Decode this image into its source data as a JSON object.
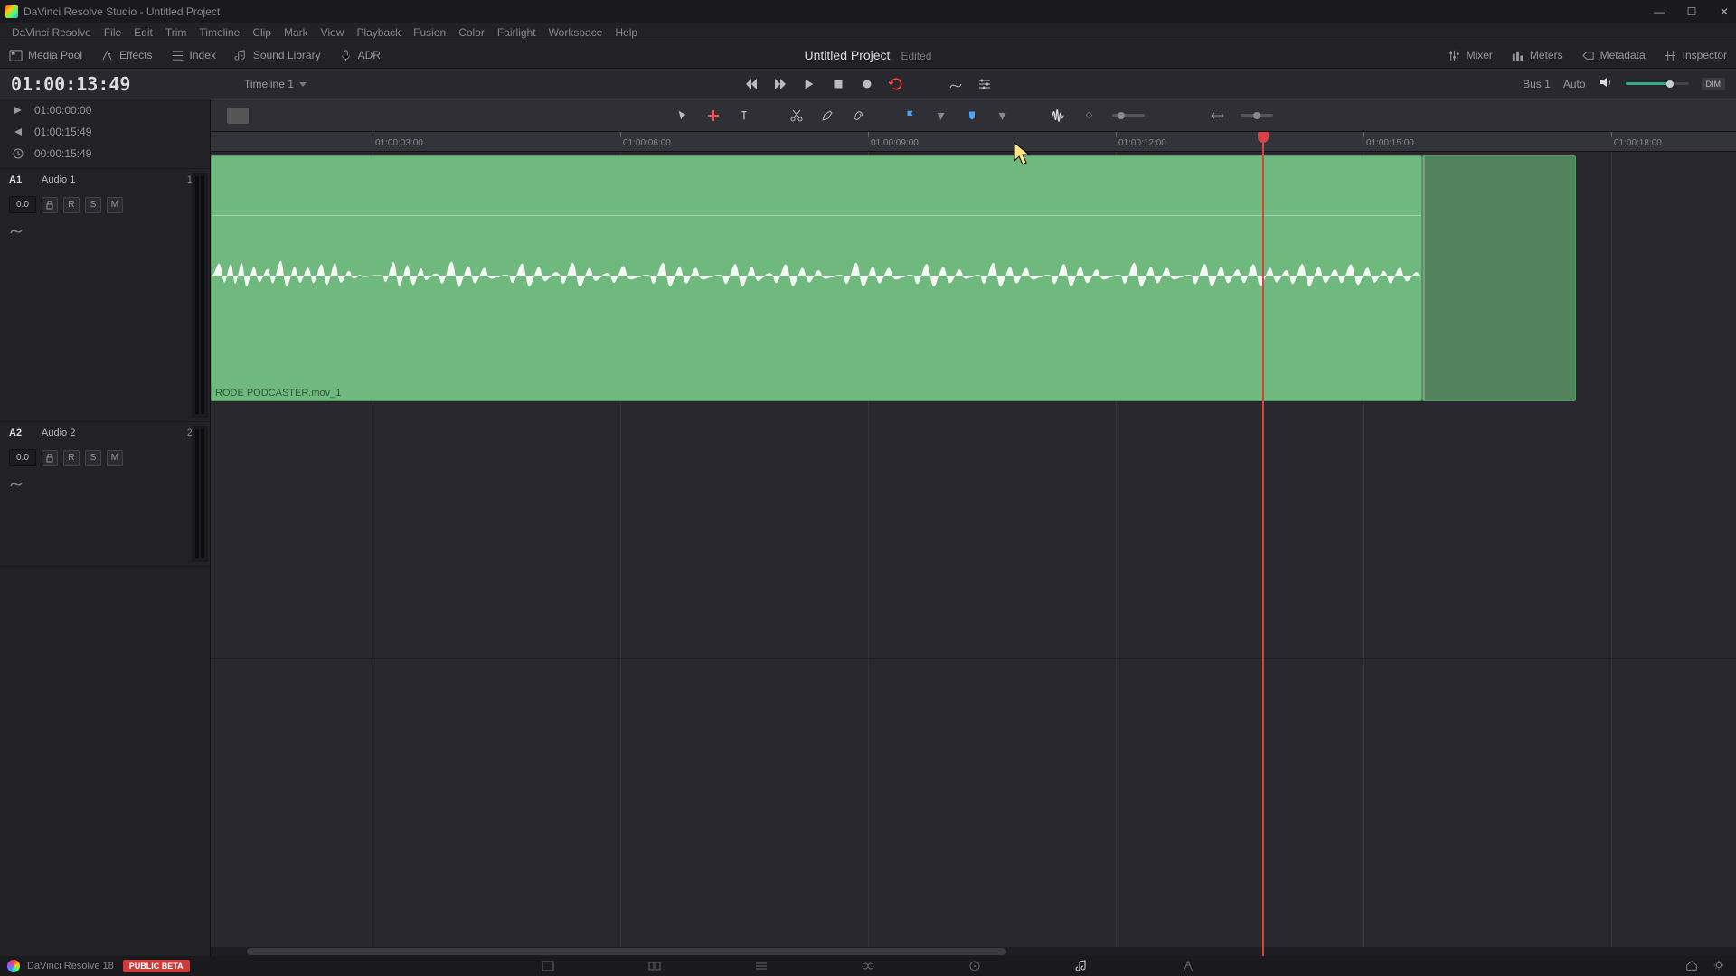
{
  "titlebar": {
    "title": "DaVinci Resolve Studio - Untitled Project"
  },
  "menubar": [
    "DaVinci Resolve",
    "File",
    "Edit",
    "Trim",
    "Timeline",
    "Clip",
    "Mark",
    "View",
    "Playback",
    "Fusion",
    "Color",
    "Fairlight",
    "Workspace",
    "Help"
  ],
  "toptools_left": [
    {
      "icon": "media-pool",
      "label": "Media Pool"
    },
    {
      "icon": "effects",
      "label": "Effects"
    },
    {
      "icon": "index",
      "label": "Index"
    },
    {
      "icon": "sound-library",
      "label": "Sound Library"
    },
    {
      "icon": "adr",
      "label": "ADR"
    }
  ],
  "toptools_right": [
    {
      "icon": "mixer",
      "label": "Mixer"
    },
    {
      "icon": "meters",
      "label": "Meters"
    },
    {
      "icon": "metadata",
      "label": "Metadata"
    },
    {
      "icon": "inspector",
      "label": "Inspector"
    }
  ],
  "project": {
    "name": "Untitled Project",
    "state": "Edited"
  },
  "transport": {
    "timecode": "01:00:13:49",
    "timeline_name": "Timeline 1",
    "bus_label": "Bus 1",
    "auto_label": "Auto",
    "dim_label": "DIM"
  },
  "markers": [
    {
      "icon": "tri-right",
      "label": "01:00:00:00"
    },
    {
      "icon": "tri-left",
      "label": "01:00:15:49"
    },
    {
      "icon": "clock",
      "label": "00:00:15:49"
    }
  ],
  "ruler_ticks": [
    {
      "pos": 179,
      "label": "01:00:03:00"
    },
    {
      "pos": 453,
      "label": "01:00:06:00"
    },
    {
      "pos": 727,
      "label": "01:00:09:00"
    },
    {
      "pos": 1001,
      "label": "01:00:12:00"
    },
    {
      "pos": 1275,
      "label": "01:00:15:00"
    },
    {
      "pos": 1549,
      "label": "01:00:18:00"
    }
  ],
  "tracks": {
    "a1": {
      "id": "A1",
      "name": "Audio 1",
      "ch": "1.0",
      "db": "0.0"
    },
    "a2": {
      "id": "A2",
      "name": "Audio 2",
      "ch": "2.0",
      "db": "0.0"
    }
  },
  "clip": {
    "name": "RODE PODCASTER.mov_1"
  },
  "bottom": {
    "app": "DaVinci Resolve 18",
    "beta": "PUBLIC BETA"
  }
}
